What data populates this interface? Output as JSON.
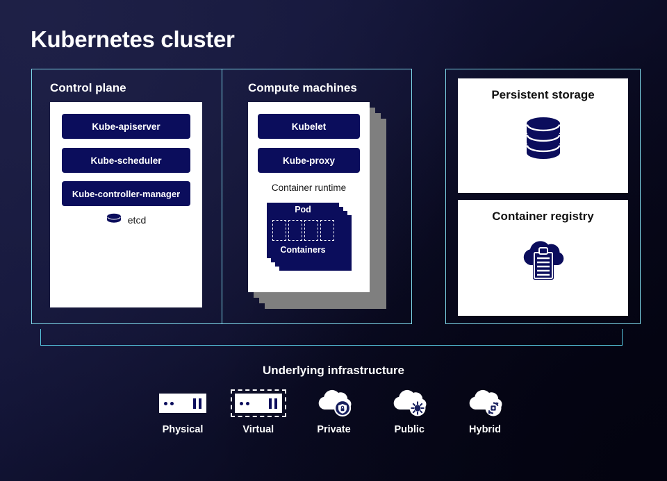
{
  "title": "Kubernetes cluster",
  "colors": {
    "accent_cyan": "#7ed8ea",
    "navy": "#0b0d5c",
    "card_white": "#ffffff",
    "stack_gray": "#7f7f7f",
    "bg_dark": "#191b3d"
  },
  "cluster": {
    "control_plane": {
      "title": "Control plane",
      "components": [
        {
          "label": "Kube-apiserver",
          "style": "pill"
        },
        {
          "label": "Kube-scheduler",
          "style": "pill"
        },
        {
          "label": "Kube-controller-manager",
          "style": "pill"
        }
      ],
      "etcd": {
        "label": "etcd",
        "icon": "database-disc-icon"
      }
    },
    "compute_machines": {
      "title": "Compute machines",
      "components": [
        {
          "label": "Kubelet",
          "style": "pill"
        },
        {
          "label": "Kube-proxy",
          "style": "pill"
        }
      ],
      "container_runtime_label": "Container runtime",
      "pod": {
        "top_label": "Pod",
        "bottom_label": "Containers",
        "container_count": 4,
        "stacked_copies": 3
      },
      "stacked_copies": 3
    }
  },
  "services": [
    {
      "title": "Persistent storage",
      "icon": "database-stack-icon"
    },
    {
      "title": "Container registry",
      "icon": "cloud-clipboard-icon"
    }
  ],
  "infrastructure": {
    "title": "Underlying infrastructure",
    "items": [
      {
        "label": "Physical",
        "icon": "server-icon"
      },
      {
        "label": "Virtual",
        "icon": "server-dashed-icon"
      },
      {
        "label": "Private",
        "icon": "cloud-shield-lock-icon"
      },
      {
        "label": "Public",
        "icon": "cloud-sun-icon"
      },
      {
        "label": "Hybrid",
        "icon": "cloud-sync-icon"
      }
    ]
  }
}
